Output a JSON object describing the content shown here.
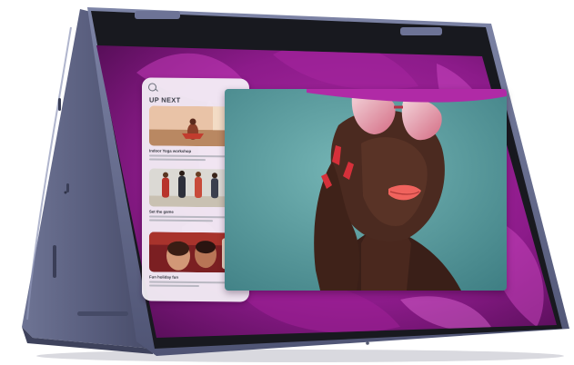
{
  "up_next": {
    "title": "UP NEXT",
    "items": [
      {
        "title": "Indoor Yoga workshop"
      },
      {
        "title": "Set the game"
      },
      {
        "title": "Fun holiday fun"
      }
    ]
  },
  "colors": {
    "chassis": "#5d6280",
    "wallpaper": "#8c1b8a",
    "video_background": "#5fa0a2",
    "panel": "#f4f0f6"
  },
  "icons": [
    "search-icon",
    "webcam-icon"
  ]
}
